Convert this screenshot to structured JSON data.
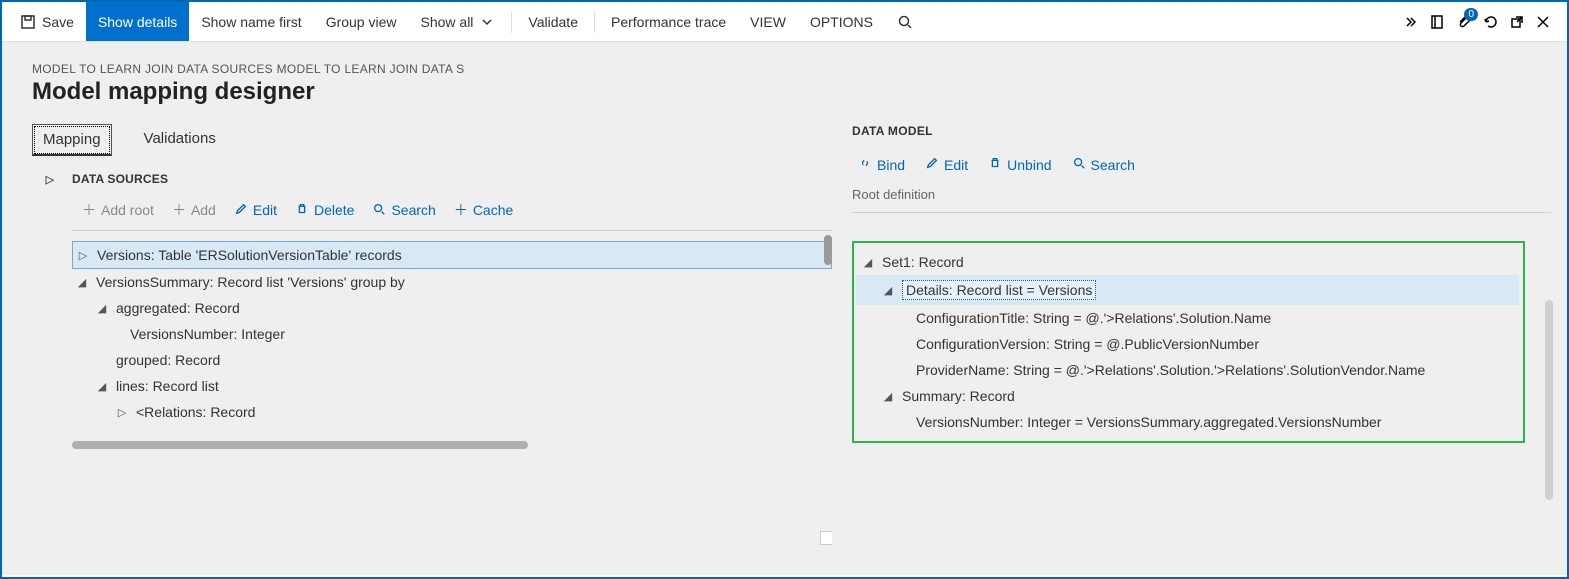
{
  "toolbar": {
    "save": "Save",
    "show_details": "Show details",
    "show_name_first": "Show name first",
    "group_view": "Group view",
    "show_all": "Show all",
    "validate": "Validate",
    "perf_trace": "Performance trace",
    "view": "VIEW",
    "options": "OPTIONS",
    "badge_count": "0"
  },
  "breadcrumb": "MODEL TO LEARN JOIN DATA SOURCES MODEL TO LEARN JOIN DATA S",
  "page_title": "Model mapping designer",
  "tabs": {
    "mapping": "Mapping",
    "validations": "Validations"
  },
  "data_sources": {
    "header": "DATA SOURCES",
    "actions": {
      "add_root": "Add root",
      "add": "Add",
      "edit": "Edit",
      "delete": "Delete",
      "search": "Search",
      "cache": "Cache"
    },
    "tree": {
      "n0": "Versions: Table 'ERSolutionVersionTable' records",
      "n1": "VersionsSummary: Record list 'Versions' group by",
      "n2": "aggregated: Record",
      "n3": "VersionsNumber: Integer",
      "n4": "grouped: Record",
      "n5": "lines: Record list",
      "n6": "<Relations: Record"
    }
  },
  "data_model": {
    "header": "DATA MODEL",
    "actions": {
      "bind": "Bind",
      "edit": "Edit",
      "unbind": "Unbind",
      "search": "Search"
    },
    "root_def": "Root definition",
    "tree": {
      "n0": "Set1: Record",
      "n1": "Details: Record list = Versions",
      "n2": "ConfigurationTitle: String = @.'>Relations'.Solution.Name",
      "n3": "ConfigurationVersion: String = @.PublicVersionNumber",
      "n4": "ProviderName: String = @.'>Relations'.Solution.'>Relations'.SolutionVendor.Name",
      "n5": "Summary: Record",
      "n6": "VersionsNumber: Integer = VersionsSummary.aggregated.VersionsNumber"
    }
  }
}
